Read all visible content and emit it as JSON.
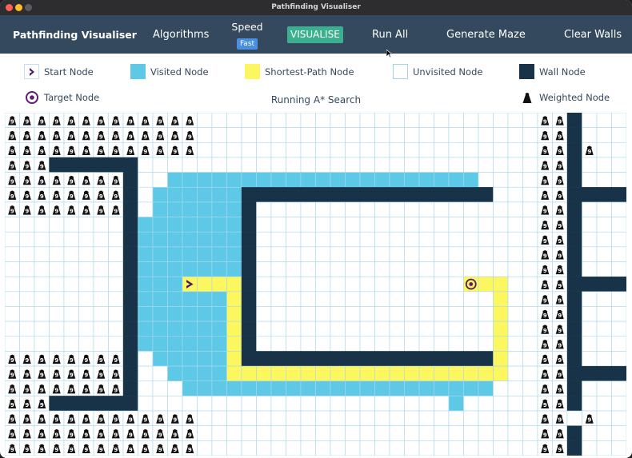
{
  "window": {
    "title": "Pathfinding Visualiser"
  },
  "navbar": {
    "brand": "Pathfinding Visualiser",
    "algorithms": "Algorithms",
    "speed_label": "Speed",
    "speed_value": "Fast",
    "visualise": "VISUALISE",
    "run_all": "Run All",
    "generate_maze": "Generate Maze",
    "clear_walls": "Clear Walls"
  },
  "legend": {
    "start": "Start Node",
    "visited": "Visited Node",
    "shortest": "Shortest-Path Node",
    "unvisited": "Unvisited Node",
    "wall": "Wall Node",
    "target": "Target Node",
    "weighted": "Weighted Node",
    "status": "Running A* Search"
  },
  "colors": {
    "navbar": "#34495e",
    "visualise_button": "#3bb08f",
    "speed_badge": "#4a90e2",
    "visited": "#5ec9e6",
    "shortest_path": "#fdf75f",
    "wall": "#183247",
    "grid_line": "#a9d8ef",
    "target_ring": "#5b1e6e",
    "start_arrow": "#4a1561"
  },
  "grid": {
    "cols": 42,
    "rows": 23,
    "start": [
      12,
      11
    ],
    "target": [
      31,
      11
    ],
    "walls": [
      [
        3,
        3
      ],
      [
        4,
        3
      ],
      [
        5,
        3
      ],
      [
        6,
        3
      ],
      [
        7,
        3
      ],
      [
        8,
        3
      ],
      [
        8,
        4
      ],
      [
        8,
        5
      ],
      [
        8,
        6
      ],
      [
        8,
        7
      ],
      [
        8,
        8
      ],
      [
        8,
        9
      ],
      [
        8,
        10
      ],
      [
        8,
        11
      ],
      [
        8,
        12
      ],
      [
        8,
        13
      ],
      [
        8,
        14
      ],
      [
        8,
        15
      ],
      [
        8,
        16
      ],
      [
        8,
        17
      ],
      [
        8,
        18
      ],
      [
        3,
        19
      ],
      [
        4,
        19
      ],
      [
        5,
        19
      ],
      [
        6,
        19
      ],
      [
        7,
        19
      ],
      [
        8,
        19
      ],
      [
        16,
        5
      ],
      [
        17,
        5
      ],
      [
        18,
        5
      ],
      [
        19,
        5
      ],
      [
        20,
        5
      ],
      [
        21,
        5
      ],
      [
        22,
        5
      ],
      [
        23,
        5
      ],
      [
        24,
        5
      ],
      [
        25,
        5
      ],
      [
        26,
        5
      ],
      [
        27,
        5
      ],
      [
        28,
        5
      ],
      [
        29,
        5
      ],
      [
        30,
        5
      ],
      [
        31,
        5
      ],
      [
        32,
        5
      ],
      [
        16,
        6
      ],
      [
        16,
        7
      ],
      [
        16,
        8
      ],
      [
        16,
        9
      ],
      [
        16,
        10
      ],
      [
        16,
        11
      ],
      [
        16,
        12
      ],
      [
        16,
        13
      ],
      [
        16,
        14
      ],
      [
        16,
        15
      ],
      [
        17,
        16
      ],
      [
        18,
        16
      ],
      [
        19,
        16
      ],
      [
        20,
        16
      ],
      [
        21,
        16
      ],
      [
        22,
        16
      ],
      [
        23,
        16
      ],
      [
        24,
        16
      ],
      [
        25,
        16
      ],
      [
        26,
        16
      ],
      [
        27,
        16
      ],
      [
        28,
        16
      ],
      [
        29,
        16
      ],
      [
        30,
        16
      ],
      [
        31,
        16
      ],
      [
        32,
        16
      ],
      [
        16,
        16
      ],
      [
        38,
        0
      ],
      [
        38,
        1
      ],
      [
        38,
        2
      ],
      [
        38,
        3
      ],
      [
        38,
        4
      ],
      [
        38,
        5
      ],
      [
        38,
        6
      ],
      [
        38,
        7
      ],
      [
        38,
        8
      ],
      [
        38,
        9
      ],
      [
        38,
        10
      ],
      [
        38,
        11
      ],
      [
        38,
        12
      ],
      [
        38,
        13
      ],
      [
        38,
        14
      ],
      [
        38,
        15
      ],
      [
        38,
        16
      ],
      [
        38,
        17
      ],
      [
        38,
        18
      ],
      [
        38,
        19
      ],
      [
        38,
        21
      ],
      [
        38,
        22
      ],
      [
        39,
        5
      ],
      [
        40,
        5
      ],
      [
        41,
        5
      ],
      [
        39,
        11
      ],
      [
        40,
        11
      ],
      [
        41,
        11
      ],
      [
        39,
        17
      ],
      [
        40,
        17
      ],
      [
        41,
        17
      ]
    ],
    "path": [
      [
        12,
        11
      ],
      [
        13,
        11
      ],
      [
        14,
        11
      ],
      [
        15,
        11
      ],
      [
        15,
        12
      ],
      [
        15,
        13
      ],
      [
        15,
        14
      ],
      [
        15,
        15
      ],
      [
        15,
        16
      ],
      [
        15,
        17
      ],
      [
        16,
        17
      ],
      [
        17,
        17
      ],
      [
        18,
        17
      ],
      [
        19,
        17
      ],
      [
        20,
        17
      ],
      [
        21,
        17
      ],
      [
        22,
        17
      ],
      [
        23,
        17
      ],
      [
        24,
        17
      ],
      [
        25,
        17
      ],
      [
        26,
        17
      ],
      [
        27,
        17
      ],
      [
        28,
        17
      ],
      [
        29,
        17
      ],
      [
        30,
        17
      ],
      [
        31,
        17
      ],
      [
        32,
        17
      ],
      [
        33,
        17
      ],
      [
        33,
        16
      ],
      [
        33,
        15
      ],
      [
        33,
        14
      ],
      [
        33,
        13
      ],
      [
        33,
        12
      ],
      [
        33,
        11
      ],
      [
        32,
        11
      ],
      [
        31,
        11
      ]
    ],
    "visited_rows": [
      [
        4,
        11,
        15
      ],
      [
        4,
        16,
        31
      ],
      [
        5,
        10,
        15
      ],
      [
        6,
        10,
        15
      ],
      [
        7,
        9,
        15
      ],
      [
        8,
        9,
        15
      ],
      [
        9,
        9,
        15
      ],
      [
        10,
        9,
        15
      ],
      [
        11,
        9,
        11
      ],
      [
        12,
        9,
        14
      ],
      [
        13,
        9,
        14
      ],
      [
        14,
        9,
        14
      ],
      [
        15,
        9,
        14
      ],
      [
        16,
        10,
        14
      ],
      [
        17,
        11,
        14
      ],
      [
        18,
        12,
        32
      ],
      [
        19,
        30,
        30
      ]
    ],
    "weights": [
      [
        0,
        0
      ],
      [
        1,
        0
      ],
      [
        2,
        0
      ],
      [
        3,
        0
      ],
      [
        4,
        0
      ],
      [
        5,
        0
      ],
      [
        6,
        0
      ],
      [
        7,
        0
      ],
      [
        8,
        0
      ],
      [
        9,
        0
      ],
      [
        10,
        0
      ],
      [
        11,
        0
      ],
      [
        12,
        0
      ],
      [
        0,
        1
      ],
      [
        1,
        1
      ],
      [
        2,
        1
      ],
      [
        3,
        1
      ],
      [
        4,
        1
      ],
      [
        5,
        1
      ],
      [
        6,
        1
      ],
      [
        7,
        1
      ],
      [
        8,
        1
      ],
      [
        9,
        1
      ],
      [
        10,
        1
      ],
      [
        11,
        1
      ],
      [
        12,
        1
      ],
      [
        0,
        2
      ],
      [
        1,
        2
      ],
      [
        2,
        2
      ],
      [
        3,
        2
      ],
      [
        4,
        2
      ],
      [
        5,
        2
      ],
      [
        6,
        2
      ],
      [
        7,
        2
      ],
      [
        8,
        2
      ],
      [
        9,
        2
      ],
      [
        10,
        2
      ],
      [
        11,
        2
      ],
      [
        12,
        2
      ],
      [
        0,
        3
      ],
      [
        1,
        3
      ],
      [
        2,
        3
      ],
      [
        0,
        4
      ],
      [
        1,
        4
      ],
      [
        2,
        4
      ],
      [
        3,
        4
      ],
      [
        4,
        4
      ],
      [
        5,
        4
      ],
      [
        6,
        4
      ],
      [
        7,
        4
      ],
      [
        0,
        5
      ],
      [
        1,
        5
      ],
      [
        2,
        5
      ],
      [
        3,
        5
      ],
      [
        4,
        5
      ],
      [
        5,
        5
      ],
      [
        6,
        5
      ],
      [
        7,
        5
      ],
      [
        0,
        6
      ],
      [
        1,
        6
      ],
      [
        2,
        6
      ],
      [
        3,
        6
      ],
      [
        4,
        6
      ],
      [
        5,
        6
      ],
      [
        6,
        6
      ],
      [
        7,
        6
      ],
      [
        0,
        16
      ],
      [
        1,
        16
      ],
      [
        2,
        16
      ],
      [
        3,
        16
      ],
      [
        4,
        16
      ],
      [
        5,
        16
      ],
      [
        6,
        16
      ],
      [
        7,
        16
      ],
      [
        0,
        17
      ],
      [
        1,
        17
      ],
      [
        2,
        17
      ],
      [
        3,
        17
      ],
      [
        4,
        17
      ],
      [
        5,
        17
      ],
      [
        6,
        17
      ],
      [
        7,
        17
      ],
      [
        0,
        18
      ],
      [
        1,
        18
      ],
      [
        2,
        18
      ],
      [
        3,
        18
      ],
      [
        4,
        18
      ],
      [
        5,
        18
      ],
      [
        6,
        18
      ],
      [
        7,
        18
      ],
      [
        0,
        19
      ],
      [
        1,
        19
      ],
      [
        2,
        19
      ],
      [
        0,
        20
      ],
      [
        1,
        20
      ],
      [
        2,
        20
      ],
      [
        3,
        20
      ],
      [
        4,
        20
      ],
      [
        5,
        20
      ],
      [
        6,
        20
      ],
      [
        7,
        20
      ],
      [
        8,
        20
      ],
      [
        9,
        20
      ],
      [
        10,
        20
      ],
      [
        11,
        20
      ],
      [
        12,
        20
      ],
      [
        0,
        21
      ],
      [
        1,
        21
      ],
      [
        2,
        21
      ],
      [
        3,
        21
      ],
      [
        4,
        21
      ],
      [
        5,
        21
      ],
      [
        6,
        21
      ],
      [
        7,
        21
      ],
      [
        8,
        21
      ],
      [
        9,
        21
      ],
      [
        10,
        21
      ],
      [
        11,
        21
      ],
      [
        12,
        21
      ],
      [
        0,
        22
      ],
      [
        1,
        22
      ],
      [
        2,
        22
      ],
      [
        3,
        22
      ],
      [
        4,
        22
      ],
      [
        5,
        22
      ],
      [
        6,
        22
      ],
      [
        7,
        22
      ],
      [
        8,
        22
      ],
      [
        9,
        22
      ],
      [
        10,
        22
      ],
      [
        11,
        22
      ],
      [
        12,
        22
      ],
      [
        36,
        0
      ],
      [
        37,
        0
      ],
      [
        36,
        1
      ],
      [
        37,
        1
      ],
      [
        36,
        2
      ],
      [
        37,
        2
      ],
      [
        39,
        2
      ],
      [
        36,
        3
      ],
      [
        37,
        3
      ],
      [
        36,
        4
      ],
      [
        37,
        4
      ],
      [
        36,
        5
      ],
      [
        37,
        5
      ],
      [
        36,
        6
      ],
      [
        37,
        6
      ],
      [
        36,
        7
      ],
      [
        37,
        7
      ],
      [
        36,
        8
      ],
      [
        37,
        8
      ],
      [
        36,
        9
      ],
      [
        37,
        9
      ],
      [
        36,
        10
      ],
      [
        37,
        10
      ],
      [
        36,
        11
      ],
      [
        37,
        11
      ],
      [
        36,
        12
      ],
      [
        37,
        12
      ],
      [
        36,
        13
      ],
      [
        37,
        13
      ],
      [
        36,
        14
      ],
      [
        37,
        14
      ],
      [
        36,
        15
      ],
      [
        37,
        15
      ],
      [
        36,
        16
      ],
      [
        37,
        16
      ],
      [
        36,
        17
      ],
      [
        37,
        17
      ],
      [
        36,
        18
      ],
      [
        37,
        18
      ],
      [
        36,
        19
      ],
      [
        37,
        19
      ],
      [
        36,
        20
      ],
      [
        37,
        20
      ],
      [
        39,
        20
      ],
      [
        36,
        21
      ],
      [
        37,
        21
      ],
      [
        36,
        22
      ],
      [
        37,
        22
      ]
    ]
  }
}
